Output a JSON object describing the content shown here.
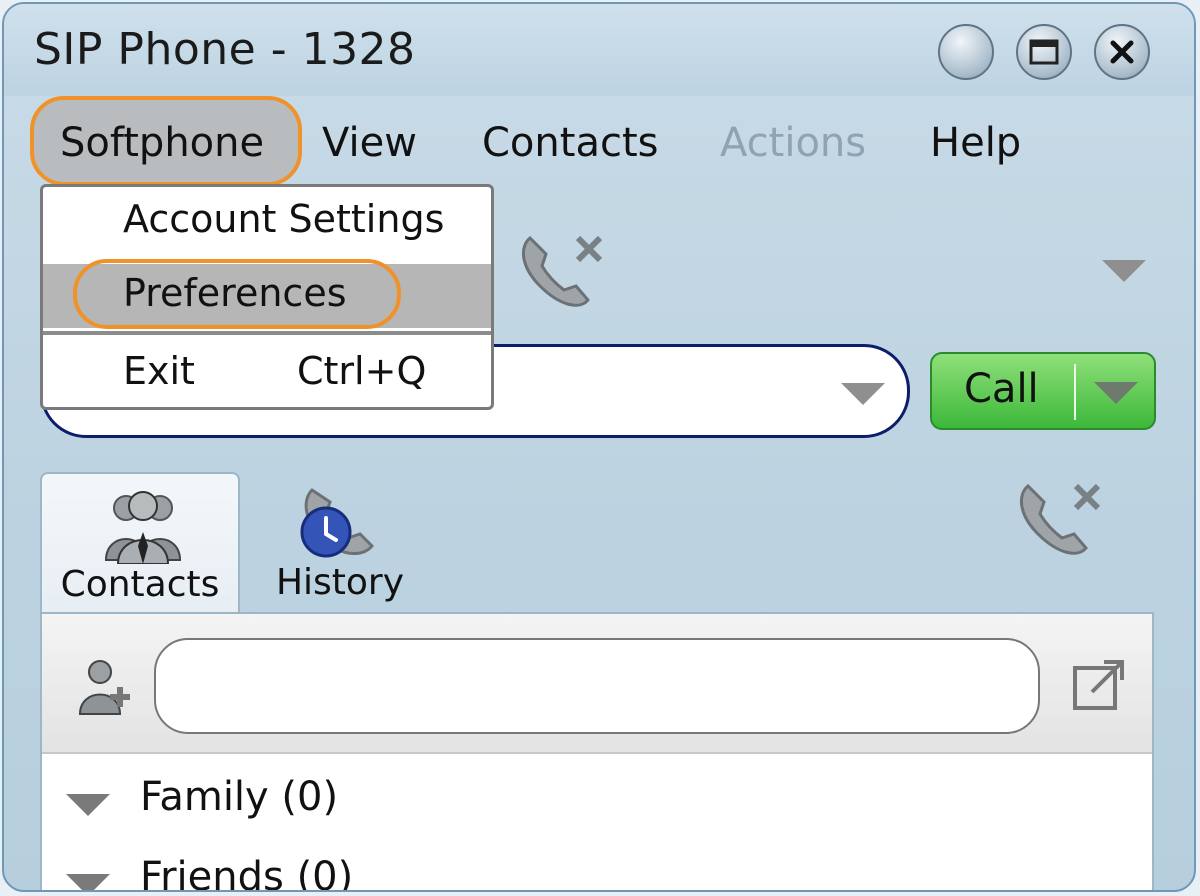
{
  "window": {
    "title": "SIP Phone - 1328"
  },
  "menubar": {
    "items": [
      {
        "label": "Softphone"
      },
      {
        "label": "View"
      },
      {
        "label": "Contacts"
      },
      {
        "label": "Actions"
      },
      {
        "label": "Help"
      }
    ]
  },
  "softphone_menu": {
    "items": [
      {
        "label": "Account Settings",
        "shortcut": ""
      },
      {
        "label": "Preferences",
        "shortcut": ""
      },
      {
        "label": "Exit",
        "shortcut": "Ctrl+Q"
      }
    ]
  },
  "dial": {
    "value": "",
    "call_label": "Call"
  },
  "tabs": [
    {
      "label": "Contacts"
    },
    {
      "label": "History"
    }
  ],
  "contacts_search": {
    "value": ""
  },
  "groups": [
    {
      "label": "Family (0)"
    },
    {
      "label": "Friends (0)"
    }
  ],
  "colors": {
    "highlight_ring": "#f0922a",
    "call_button": "#3cb83a"
  }
}
